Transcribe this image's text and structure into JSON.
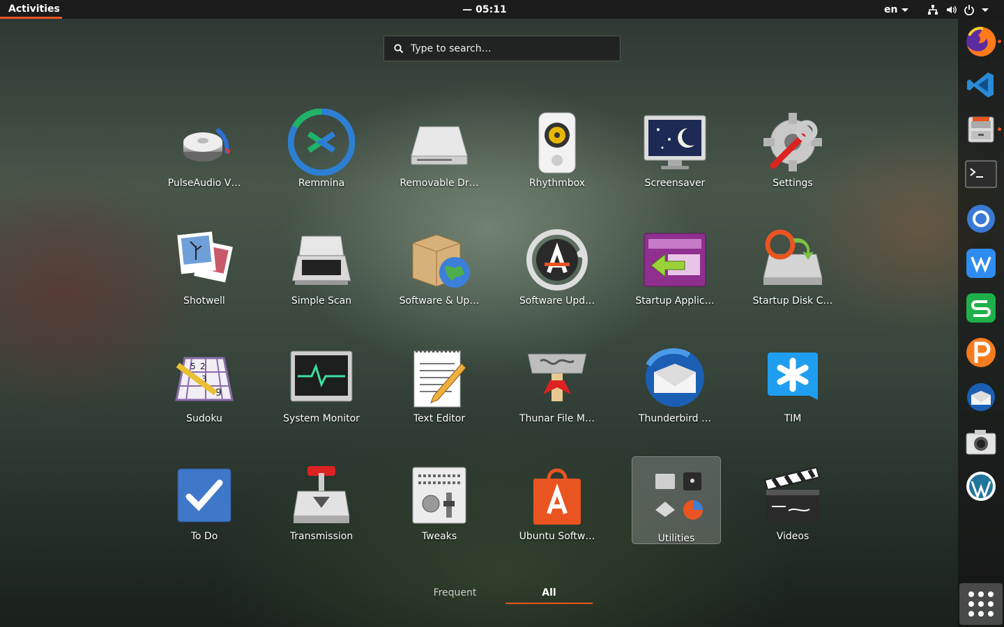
{
  "topbar": {
    "activities": "Activities",
    "clock": "— 05:11",
    "language": "en"
  },
  "search": {
    "placeholder": "Type to search…"
  },
  "apps": [
    {
      "label": "PulseAudio V…",
      "icon": "volume-knob-icon"
    },
    {
      "label": "Remmina",
      "icon": "remmina-icon"
    },
    {
      "label": "Removable Dr…",
      "icon": "drive-icon"
    },
    {
      "label": "Rhythmbox",
      "icon": "speaker-icon"
    },
    {
      "label": "Screensaver",
      "icon": "monitor-moon-icon"
    },
    {
      "label": "Settings",
      "icon": "gear-wrench-icon"
    },
    {
      "label": "Shotwell",
      "icon": "photos-icon"
    },
    {
      "label": "Simple Scan",
      "icon": "scanner-icon"
    },
    {
      "label": "Software & Up…",
      "icon": "package-globe-icon"
    },
    {
      "label": "Software Upd…",
      "icon": "updater-icon"
    },
    {
      "label": "Startup Applic…",
      "icon": "startup-app-icon"
    },
    {
      "label": "Startup Disk C…",
      "icon": "startup-disk-icon"
    },
    {
      "label": "Sudoku",
      "icon": "sudoku-icon"
    },
    {
      "label": "System Monitor",
      "icon": "heartbeat-monitor-icon"
    },
    {
      "label": "Text Editor",
      "icon": "notepad-icon"
    },
    {
      "label": "Thunar File M…",
      "icon": "thunar-icon"
    },
    {
      "label": "Thunderbird …",
      "icon": "thunderbird-icon"
    },
    {
      "label": "TIM",
      "icon": "tim-icon"
    },
    {
      "label": "To Do",
      "icon": "checkbox-icon"
    },
    {
      "label": "Transmission",
      "icon": "transmission-icon"
    },
    {
      "label": "Tweaks",
      "icon": "tweaks-icon"
    },
    {
      "label": "Ubuntu Softw…",
      "icon": "shopping-bag-icon"
    },
    {
      "label": "Utilities",
      "icon": "folder-icon",
      "folder": true
    },
    {
      "label": "Videos",
      "icon": "clapperboard-icon"
    }
  ],
  "tabs": {
    "frequent": "Frequent",
    "all": "All"
  },
  "dock": [
    {
      "name": "firefox",
      "running": true
    },
    {
      "name": "vscode",
      "running": false
    },
    {
      "name": "files",
      "running": true
    },
    {
      "name": "terminal",
      "running": false
    },
    {
      "name": "chromium",
      "running": false
    },
    {
      "name": "wps-writer",
      "running": false
    },
    {
      "name": "wps-spreadsheets",
      "running": false
    },
    {
      "name": "wps-presentation",
      "running": false
    },
    {
      "name": "thunderbird",
      "running": false
    },
    {
      "name": "cheese",
      "running": false
    },
    {
      "name": "wordpress",
      "running": false
    }
  ],
  "colors": {
    "accent": "#e95420",
    "topbar": "#1b1b1b"
  }
}
